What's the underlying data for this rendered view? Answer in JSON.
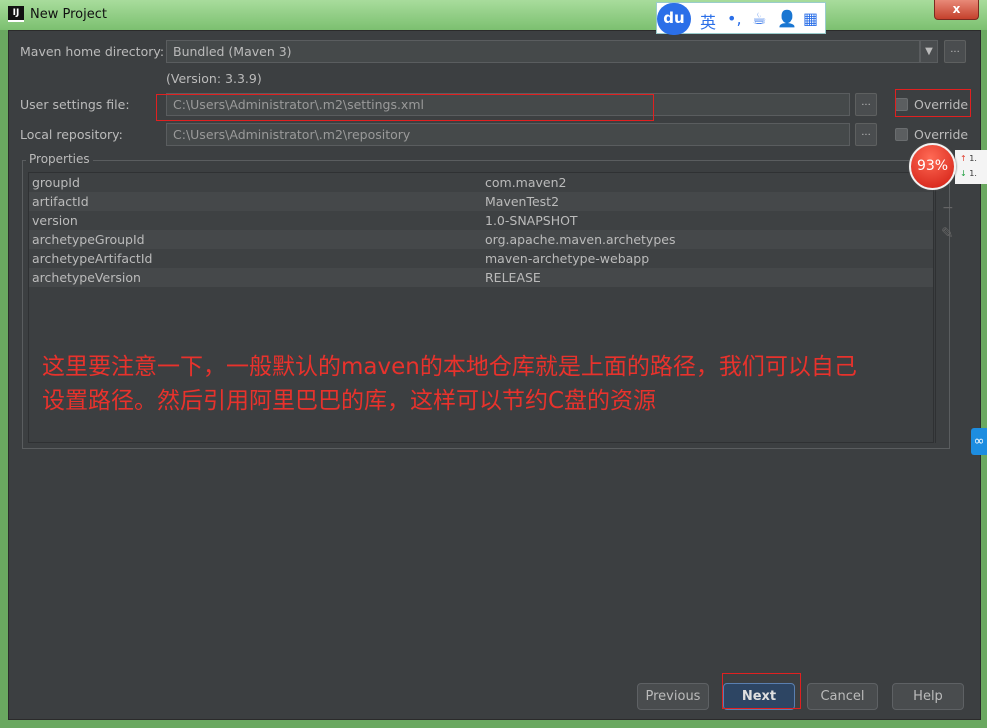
{
  "window": {
    "title": "New Project",
    "close": "x",
    "icon": "IJ"
  },
  "form": {
    "maven_home_label": "Maven home directory:",
    "maven_home_value": "Bundled (Maven 3)",
    "version": "(Version: 3.3.9)",
    "user_settings_label": "User settings file:",
    "user_settings_value": "C:\\Users\\Administrator\\.m2\\settings.xml",
    "local_repo_label": "Local repository:",
    "local_repo_value": "C:\\Users\\Administrator\\.m2\\repository",
    "override": "Override",
    "browse": "...",
    "dropdown": "▼"
  },
  "properties": {
    "title": "Properties",
    "rows": [
      {
        "key": "groupId",
        "value": "com.maven2"
      },
      {
        "key": "artifactId",
        "value": "MavenTest2"
      },
      {
        "key": "version",
        "value": "1.0-SNAPSHOT"
      },
      {
        "key": "archetypeGroupId",
        "value": "org.apache.maven.archetypes"
      },
      {
        "key": "archetypeArtifactId",
        "value": "maven-archetype-webapp"
      },
      {
        "key": "archetypeVersion",
        "value": "RELEASE"
      }
    ],
    "tools": {
      "add": "+",
      "remove": "−",
      "edit": "✎"
    }
  },
  "annotation": {
    "line1": "这里要注意一下，一般默认的maven的本地仓库就是上面的路径，我们可以自己",
    "line2": "设置路径。然后引用阿里巴巴的库，这样可以节约C盘的资源",
    "color": "#e8322c"
  },
  "buttons": {
    "previous": "Previous",
    "next": "Next",
    "cancel": "Cancel",
    "help": "Help"
  },
  "overlays": {
    "ime": {
      "logo": "du",
      "items": [
        "英",
        "•,",
        "☕",
        "👤",
        "▦"
      ]
    },
    "speed_ball": {
      "percent": "93%",
      "up": "1.",
      "down": "1."
    }
  }
}
